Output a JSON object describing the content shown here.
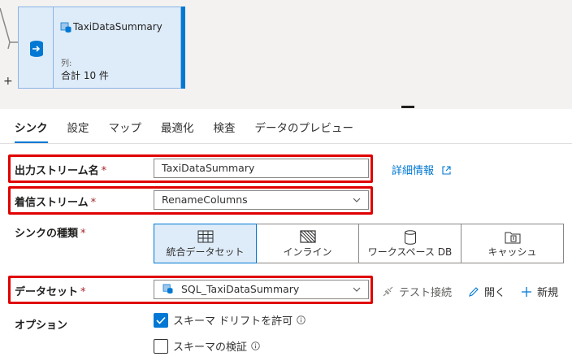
{
  "canvas": {
    "node": {
      "title": "TaxiDataSummary",
      "columns_label": "列:",
      "columns_value": "合計 10 件"
    },
    "add_label": "+"
  },
  "tabs": [
    {
      "label": "シンク",
      "active": true
    },
    {
      "label": "設定",
      "active": false
    },
    {
      "label": "マップ",
      "active": false
    },
    {
      "label": "最適化",
      "active": false
    },
    {
      "label": "検査",
      "active": false
    },
    {
      "label": "データのプレビュー",
      "active": false
    }
  ],
  "form": {
    "output_stream": {
      "label": "出力ストリーム名",
      "required": "*",
      "value": "TaxiDataSummary"
    },
    "more_info_link": "詳細情報",
    "incoming_stream": {
      "label": "着信ストリーム",
      "required": "*",
      "value": "RenameColumns"
    },
    "sink_type": {
      "label": "シンクの種類",
      "required": "*",
      "options": [
        {
          "label": "統合データセット",
          "icon": "table-icon",
          "selected": true
        },
        {
          "label": "インライン",
          "icon": "inline-hatch-icon",
          "selected": false
        },
        {
          "label": "ワークスペース DB",
          "icon": "database-icon",
          "selected": false
        },
        {
          "label": "キャッシュ",
          "icon": "cache-icon",
          "selected": false
        }
      ]
    },
    "dataset": {
      "label": "データセット",
      "required": "*",
      "value": "SQL_TaxiDataSummary"
    },
    "commands": {
      "test_connection": "テスト接続",
      "open": "開く",
      "new": "新規"
    },
    "options": {
      "label": "オプション",
      "allow_schema_drift": {
        "label": "スキーマ ドリフトを許可",
        "checked": true
      },
      "validate_schema": {
        "label": "スキーマの検証",
        "checked": false
      }
    }
  },
  "colors": {
    "accent": "#0078d4",
    "highlight": "#e00000",
    "node_fill": "#deecf9"
  }
}
